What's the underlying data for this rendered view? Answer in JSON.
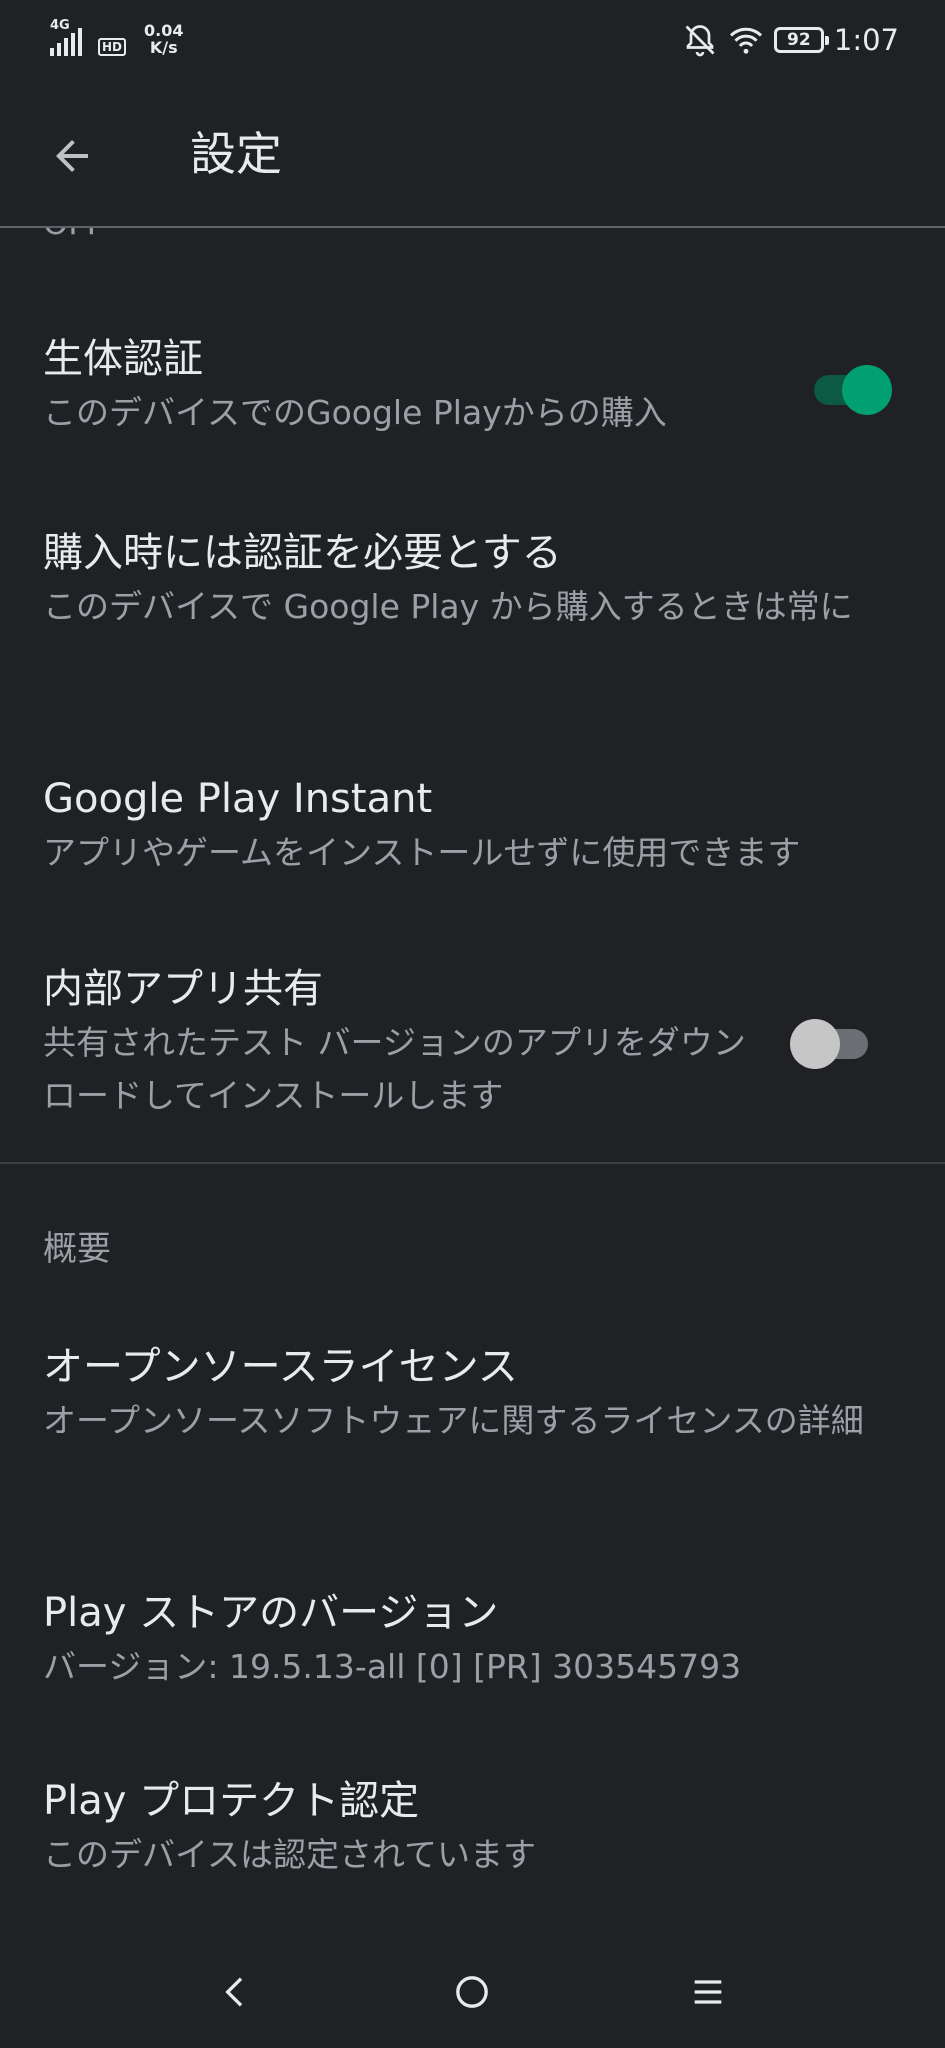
{
  "status_bar": {
    "network": "4G",
    "hd": "HD",
    "speed_value": "0.04",
    "speed_unit": "K/s",
    "battery": "92",
    "time": "1:07",
    "icons": [
      "silent-bell-icon",
      "wifi-icon",
      "battery-icon"
    ]
  },
  "app_bar": {
    "title": "設定",
    "back_icon": "arrow-back-icon"
  },
  "list": {
    "cutoff_text": "OFF",
    "biometric": {
      "title": "生体認証",
      "subtitle": "このデバイスでのGoogle Playからの購入",
      "toggle": "on"
    },
    "require_auth": {
      "title": "購入時には認証を必要とする",
      "subtitle": "このデバイスで Google Play から購入するときは常に"
    },
    "instant": {
      "title": "Google Play Instant",
      "subtitle": "アプリやゲームをインストールせずに使用できます"
    },
    "internal_sharing": {
      "title": "内部アプリ共有",
      "subtitle": "共有されたテスト バージョンのアプリをダウンロードしてインストールします",
      "toggle": "off"
    },
    "about_header": "概要",
    "oss": {
      "title": "オープンソースライセンス",
      "subtitle": "オープンソースソフトウェアに関するライセンスの詳細"
    },
    "version": {
      "title": "Play ストアのバージョン",
      "subtitle": "バージョン: 19.5.13-all [0] [PR] 303545793"
    },
    "protect": {
      "title": "Play プロテクト認定",
      "subtitle": "このデバイスは認定されています"
    }
  },
  "nav_bar": {
    "icons": [
      "nav-back-icon",
      "nav-home-icon",
      "nav-menu-icon"
    ]
  },
  "colors": {
    "background": "#202124",
    "text_primary": "#e8eaed",
    "text_secondary": "#9aa0a6",
    "accent": "#01a071"
  }
}
